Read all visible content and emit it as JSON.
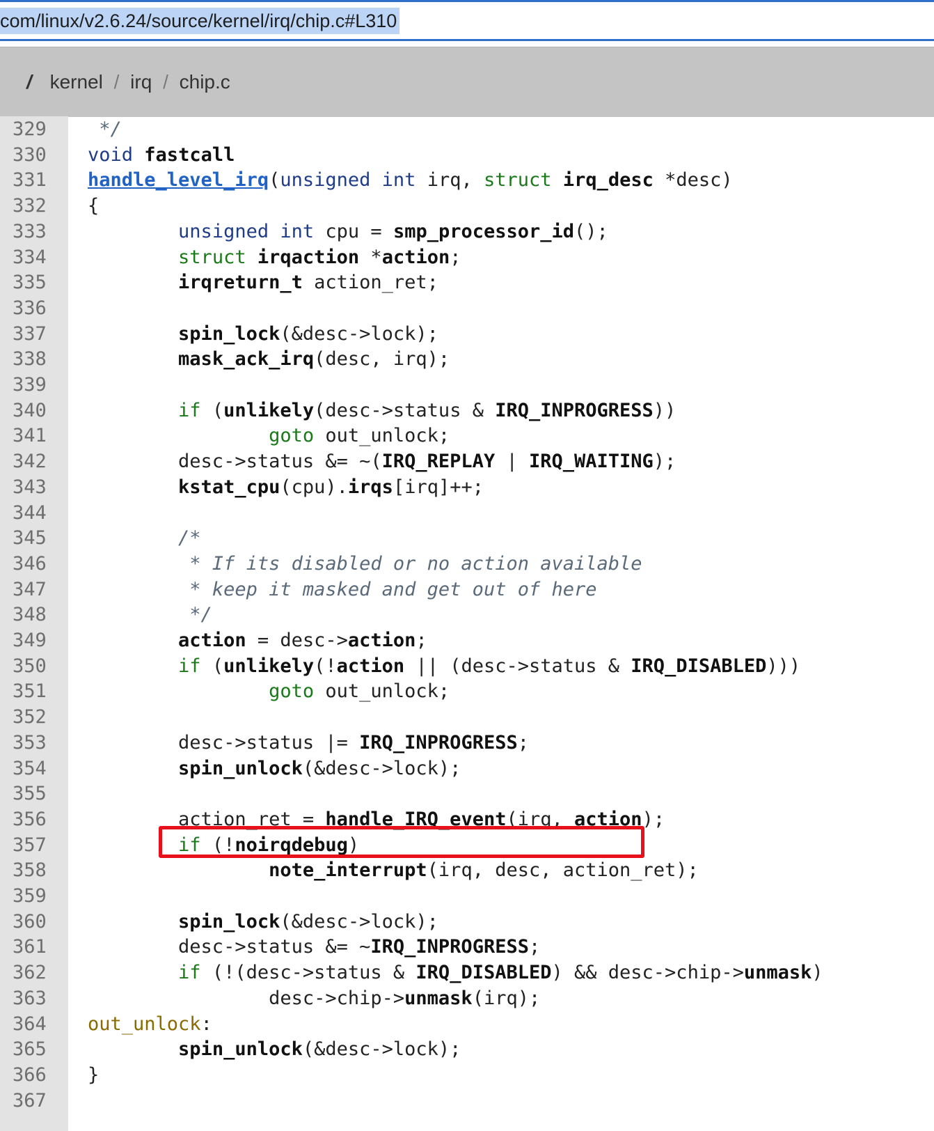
{
  "browser": {
    "url_text": "com/linux/v2.6.24/source/kernel/irq/chip.c#L310"
  },
  "breadcrumb": {
    "root": "/",
    "items": [
      "kernel",
      "irq",
      "chip.c"
    ],
    "separator": "/"
  },
  "code": {
    "highlighted_line": 356,
    "lines": [
      {
        "n": "329",
        "html": "<span class=\"cm\"> */</span>"
      },
      {
        "n": "330",
        "html": "<span class=\"kw\">void</span> <span class=\"b\">fastcall</span>"
      },
      {
        "n": "331",
        "html": "<span class=\"fn\">handle_level_irq</span>(<span class=\"kw\">unsigned</span> <span class=\"kw\">int</span> irq, <span class=\"kwg\">struct</span> <span class=\"b\">irq_desc</span> *desc)"
      },
      {
        "n": "332",
        "html": "{"
      },
      {
        "n": "333",
        "html": "        <span class=\"kw\">unsigned</span> <span class=\"kw\">int</span> cpu = <span class=\"b\">smp_processor_id</span>();"
      },
      {
        "n": "334",
        "html": "        <span class=\"kwg\">struct</span> <span class=\"b\">irqaction</span> *<span class=\"b\">action</span>;"
      },
      {
        "n": "335",
        "html": "        <span class=\"b\">irqreturn_t</span> action_ret;"
      },
      {
        "n": "336",
        "html": ""
      },
      {
        "n": "337",
        "html": "        <span class=\"b\">spin_lock</span>(&amp;desc-&gt;lock);"
      },
      {
        "n": "338",
        "html": "        <span class=\"b\">mask_ack_irq</span>(desc, irq);"
      },
      {
        "n": "339",
        "html": ""
      },
      {
        "n": "340",
        "html": "        <span class=\"kwg\">if</span> (<span class=\"b\">unlikely</span>(desc-&gt;status &amp; <span class=\"b\">IRQ_INPROGRESS</span>))"
      },
      {
        "n": "341",
        "html": "                <span class=\"kwg\">goto</span> out_unlock;"
      },
      {
        "n": "342",
        "html": "        desc-&gt;status &amp;= ~(<span class=\"b\">IRQ_REPLAY</span> | <span class=\"b\">IRQ_WAITING</span>);"
      },
      {
        "n": "343",
        "html": "        <span class=\"b\">kstat_cpu</span>(cpu).<span class=\"b\">irqs</span>[irq]++;"
      },
      {
        "n": "344",
        "html": ""
      },
      {
        "n": "345",
        "html": "        <span class=\"cm\">/*</span>"
      },
      {
        "n": "346",
        "html": "<span class=\"cm\">         * If its disabled or no action available</span>"
      },
      {
        "n": "347",
        "html": "<span class=\"cm\">         * keep it masked and get out of here</span>"
      },
      {
        "n": "348",
        "html": "<span class=\"cm\">         */</span>"
      },
      {
        "n": "349",
        "html": "        <span class=\"b\">action</span> = desc-&gt;<span class=\"b\">action</span>;"
      },
      {
        "n": "350",
        "html": "        <span class=\"kwg\">if</span> (<span class=\"b\">unlikely</span>(!<span class=\"b\">action</span> || (desc-&gt;status &amp; <span class=\"b\">IRQ_DISABLED</span>)))"
      },
      {
        "n": "351",
        "html": "                <span class=\"kwg\">goto</span> out_unlock;"
      },
      {
        "n": "352",
        "html": ""
      },
      {
        "n": "353",
        "html": "        desc-&gt;status |= <span class=\"b\">IRQ_INPROGRESS</span>;"
      },
      {
        "n": "354",
        "html": "        <span class=\"b\">spin_unlock</span>(&amp;desc-&gt;lock);"
      },
      {
        "n": "355",
        "html": ""
      },
      {
        "n": "356",
        "html": "        action_ret = <span class=\"b\">handle_IRQ_event</span>(irq, <span class=\"b\">action</span>);"
      },
      {
        "n": "357",
        "html": "        <span class=\"kwg\">if</span> (!<span class=\"b\">noirqdebug</span>)"
      },
      {
        "n": "358",
        "html": "                <span class=\"b\">note_interrupt</span>(irq, desc, action_ret);"
      },
      {
        "n": "359",
        "html": ""
      },
      {
        "n": "360",
        "html": "        <span class=\"b\">spin_lock</span>(&amp;desc-&gt;lock);"
      },
      {
        "n": "361",
        "html": "        desc-&gt;status &amp;= ~<span class=\"b\">IRQ_INPROGRESS</span>;"
      },
      {
        "n": "362",
        "html": "        <span class=\"kwg\">if</span> (!(desc-&gt;status &amp; <span class=\"b\">IRQ_DISABLED</span>) &amp;&amp; desc-&gt;chip-&gt;<span class=\"b\">unmask</span>)"
      },
      {
        "n": "363",
        "html": "                desc-&gt;chip-&gt;<span class=\"b\">unmask</span>(irq);"
      },
      {
        "n": "364",
        "html": "<span class=\"lbl\">out_unlock</span>:"
      },
      {
        "n": "365",
        "html": "        <span class=\"b\">spin_unlock</span>(&amp;desc-&gt;lock);"
      },
      {
        "n": "366",
        "html": "}"
      },
      {
        "n": "367",
        "html": ""
      }
    ]
  }
}
